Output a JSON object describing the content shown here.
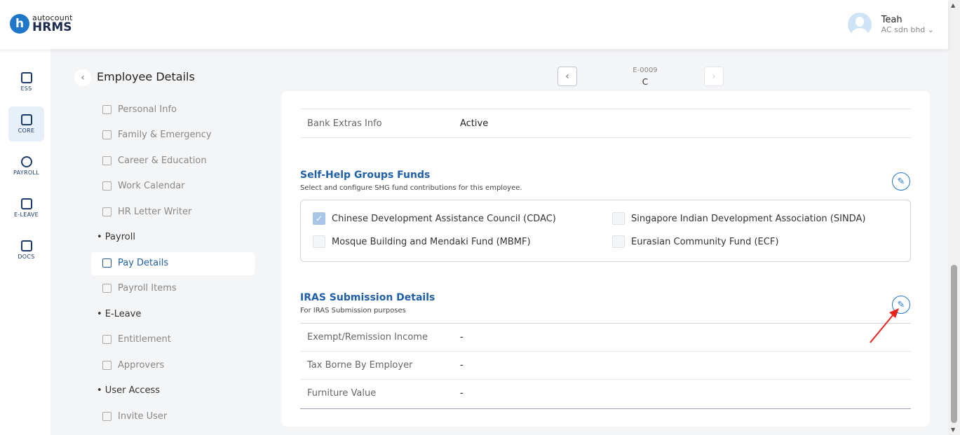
{
  "header": {
    "logo_small": "autocount",
    "logo_big": "HRMS",
    "logo_mark": "h",
    "user_name": "Teah",
    "user_company": "AC sdn bhd ⌄"
  },
  "rail": [
    {
      "label": "ESS",
      "icon": "ess-icon"
    },
    {
      "label": "CORE",
      "icon": "core-icon"
    },
    {
      "label": "PAYROLL",
      "icon": "payroll-icon"
    },
    {
      "label": "E-LEAVE",
      "icon": "calendar-icon"
    },
    {
      "label": "DOCS",
      "icon": "docs-icon"
    }
  ],
  "page": {
    "title": "Employee Details",
    "employee_code": "E-0009",
    "employee_name": "C"
  },
  "menu": {
    "personal_info": "Personal Info",
    "family": "Family & Emergency",
    "career": "Career & Education",
    "work_calendar": "Work Calendar",
    "hr_letter": "HR Letter Writer",
    "group_payroll": "• Payroll",
    "pay_details": "Pay Details",
    "payroll_items": "Payroll Items",
    "group_eleave": "• E-Leave",
    "entitlement": "Entitlement",
    "approvers": "Approvers",
    "group_access": "• User Access",
    "invite_user": "Invite User"
  },
  "bank": {
    "label": "Bank Extras Info",
    "value": "Active"
  },
  "shg": {
    "title": "Self-Help Groups Funds",
    "subtitle": "Select and configure SHG fund contributions for this employee.",
    "options": [
      {
        "label": "Chinese Development Assistance Council (CDAC)",
        "checked": true
      },
      {
        "label": "Singapore Indian Development Association (SINDA)",
        "checked": false
      },
      {
        "label": "Mosque Building and Mendaki Fund (MBMF)",
        "checked": false
      },
      {
        "label": "Eurasian Community Fund (ECF)",
        "checked": false
      }
    ]
  },
  "iras": {
    "title": "IRAS Submission Details",
    "subtitle": "For IRAS Submission purposes",
    "rows": [
      {
        "label": "Exempt/Remission Income",
        "value": "-"
      },
      {
        "label": "Tax Borne By Employer",
        "value": "-"
      },
      {
        "label": "Furniture Value",
        "value": "-"
      }
    ]
  },
  "colors": {
    "accent": "#1f5fa8",
    "annotation_arrow": "#e8231f"
  }
}
